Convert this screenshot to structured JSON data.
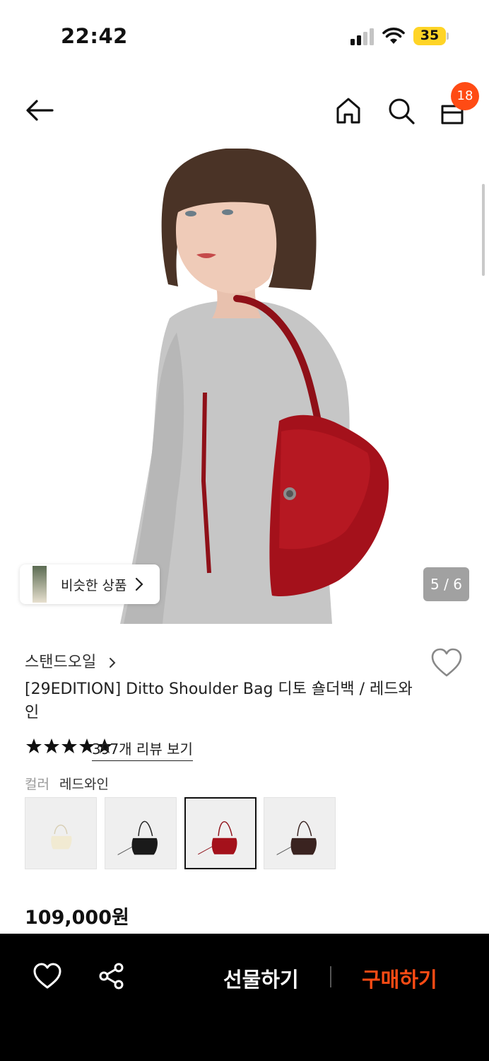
{
  "status_bar": {
    "time": "22:42",
    "battery": "35"
  },
  "header": {
    "icons": [
      "back-arrow-icon",
      "home-icon",
      "search-icon",
      "shopping-bag-icon"
    ],
    "cart_count": "18"
  },
  "gallery": {
    "similar_label": "비슷한 상품",
    "page_indicator": "5 / 6"
  },
  "product": {
    "brand": "스탠드오일",
    "title": "[29EDITION] Ditto Shoulder Bag 디토 숄더백 / 레드와인",
    "rating_stars": 5,
    "review_link": "397개 리뷰 보기",
    "color_label": "컬러",
    "color_value": "레드와인",
    "swatches": [
      {
        "bag_color": "#f1ead2",
        "selected": false
      },
      {
        "bag_color": "#1a1a1a",
        "selected": false
      },
      {
        "bag_color": "#a4111b",
        "selected": true
      },
      {
        "bag_color": "#3a2320",
        "selected": false
      }
    ],
    "price": "109,000원"
  },
  "bottom_bar": {
    "gift_label": "선물하기",
    "buy_label": "구매하기",
    "accent_color": "#ff4b14"
  }
}
